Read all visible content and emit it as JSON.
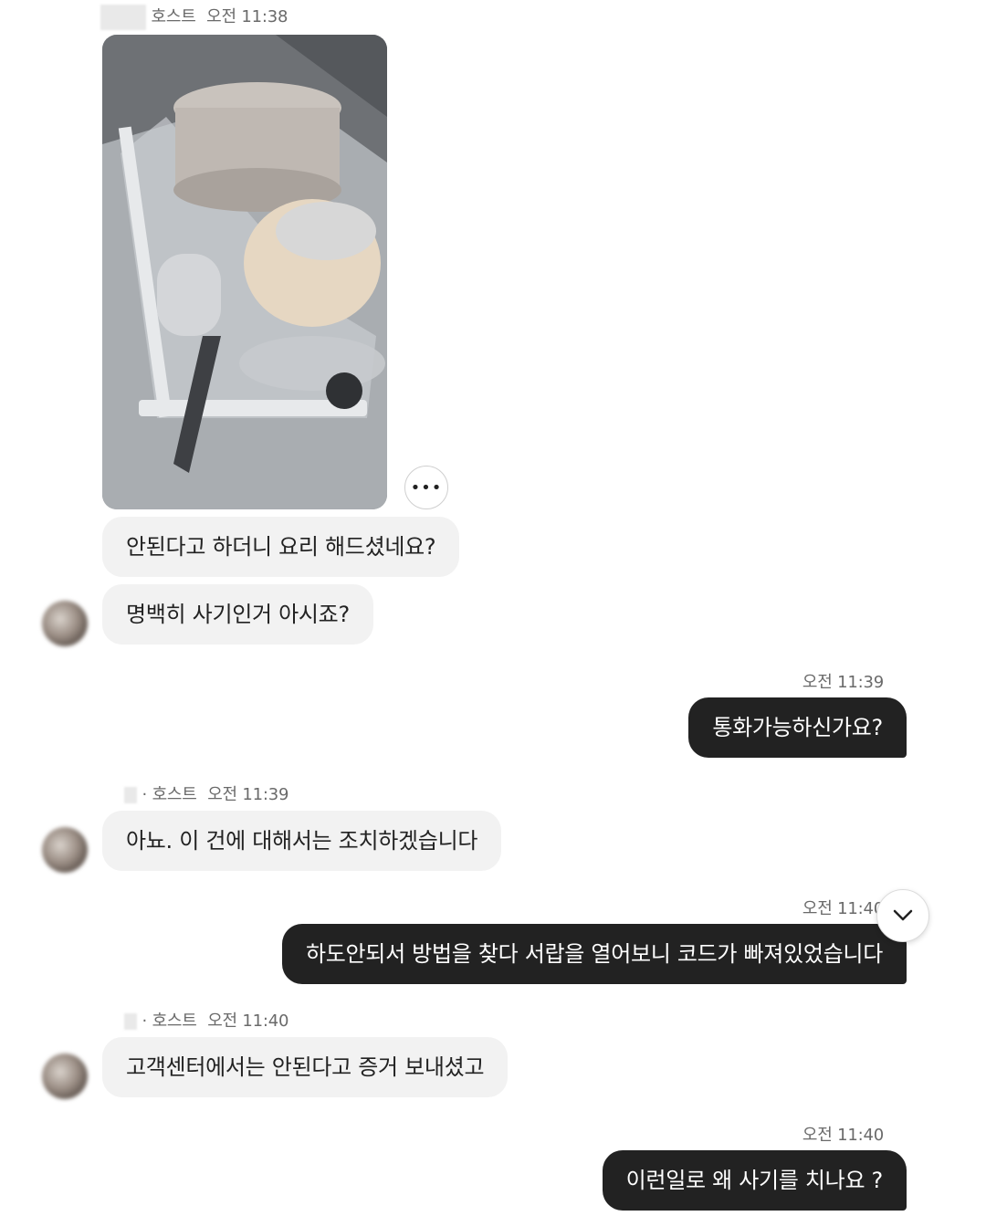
{
  "messages": [
    {
      "id": "m1",
      "sender": "host",
      "meta_role": "호스트",
      "meta_time": "오전 11:38",
      "type": "image"
    },
    {
      "id": "m2",
      "sender": "host",
      "text": "안된다고 하더니 요리 해드셨네요?"
    },
    {
      "id": "m3",
      "sender": "host",
      "text": "명백히 사기인거 아시죠?"
    },
    {
      "id": "m4",
      "sender": "me",
      "meta_time": "오전 11:39",
      "text": "통화가능하신가요?"
    },
    {
      "id": "m5",
      "sender": "host",
      "meta_role": "· 호스트",
      "meta_time": "오전 11:39",
      "text": "아뇨. 이 건에 대해서는 조치하겠습니다"
    },
    {
      "id": "m6",
      "sender": "me",
      "meta_time": "오전 11:40",
      "text": "하도안되서 방법을 찾다 서랍을 열어보니 코드가 빠져있었습니다"
    },
    {
      "id": "m7",
      "sender": "host",
      "meta_role": "· 호스트",
      "meta_time": "오전 11:40",
      "text": "고객센터에서는 안된다고 증거 보내셨고"
    },
    {
      "id": "m8",
      "sender": "me",
      "meta_time": "오전 11:40",
      "text": "이런일로 왜 사기를 치나요 ?"
    }
  ],
  "controls": {
    "more_label": "•••",
    "scroll_icon": "chevron-down-icon"
  },
  "colors": {
    "incoming_bubble": "#f2f2f2",
    "outgoing_bubble": "#222222",
    "meta_text": "#6a6a6a"
  }
}
